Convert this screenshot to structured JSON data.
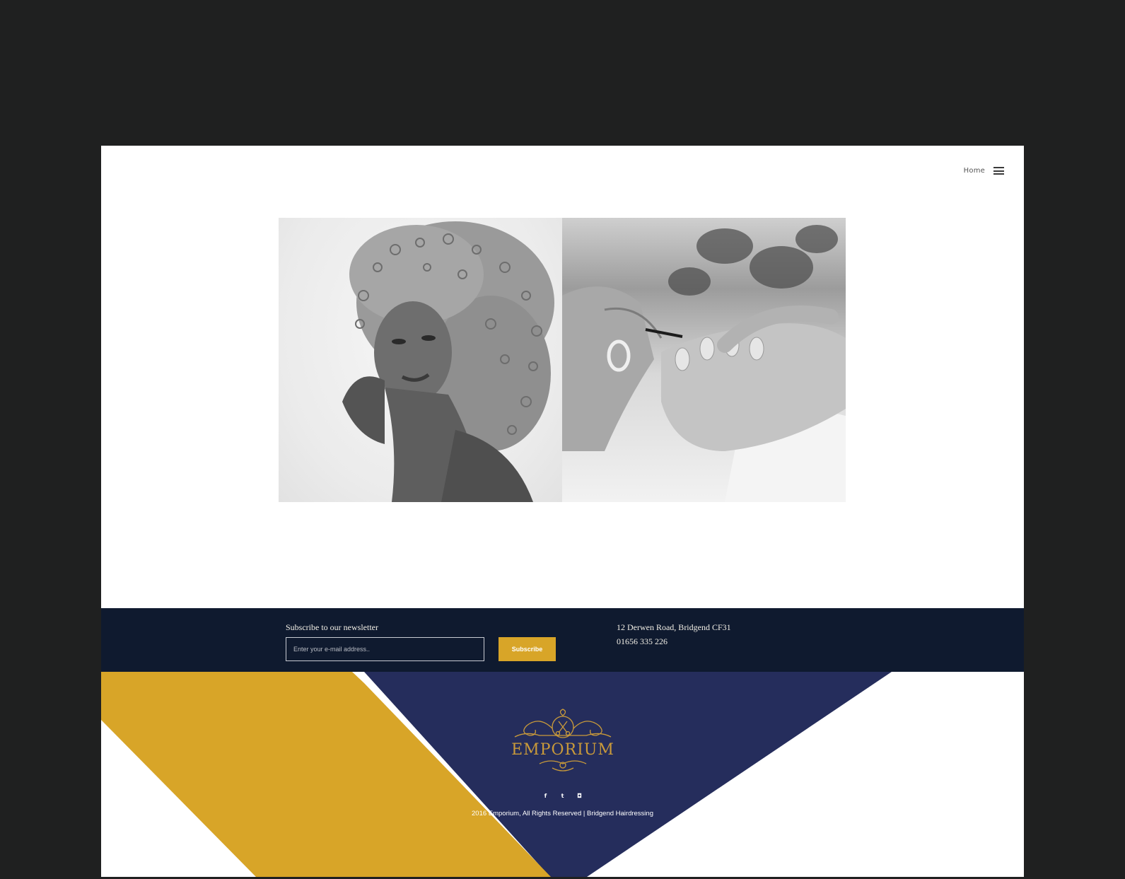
{
  "header": {
    "nav_home": "Home",
    "menu_icon": "hamburger-menu-icon"
  },
  "hero": {
    "images": [
      {
        "name": "portrait-photo",
        "kind": "black-and-white portrait"
      },
      {
        "name": "manicure-photo",
        "kind": "black-and-white nail painting"
      }
    ]
  },
  "newsletter": {
    "heading": "Subscribe to our newsletter",
    "input_placeholder": "Enter your e-mail address..",
    "input_value": "",
    "button_label": "Subscribe"
  },
  "contact": {
    "address": "12 Derwen Road, Bridgend CF31",
    "phone": "01656 335 226"
  },
  "footer": {
    "logo_text": "EMPORIUM",
    "social": [
      {
        "icon": "facebook-icon",
        "glyph": "f"
      },
      {
        "icon": "twitter-icon",
        "glyph": "t"
      },
      {
        "icon": "instagram-icon",
        "glyph": "◘"
      }
    ],
    "copyright": "2016 Emporium, All Rights Reserved | Bridgend Hairdressing"
  },
  "colors": {
    "backdrop": "#1f2020",
    "band": "#0f1a2f",
    "gold": "#d8a528",
    "navy": "#252d5c",
    "white": "#ffffff"
  }
}
